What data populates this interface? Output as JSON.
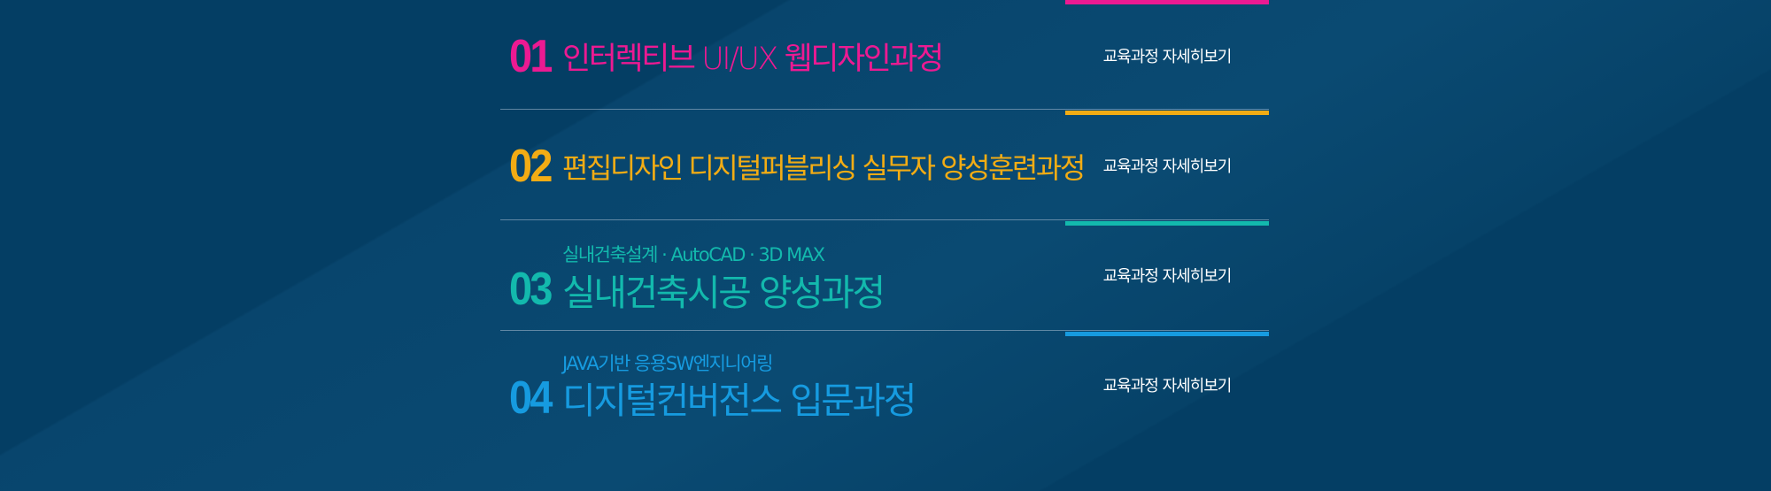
{
  "courses": [
    {
      "number": "01",
      "subtitle": "",
      "title": "인터렉티브 UI/UX 웹디자인과정",
      "detail_label": "교육과정 자세히보기",
      "color": "#ec1a92"
    },
    {
      "number": "02",
      "subtitle": "",
      "title": "편집디자인 디지털퍼블리싱 실무자 양성훈련과정",
      "detail_label": "교육과정 자세히보기",
      "color": "#f2ac14"
    },
    {
      "number": "03",
      "subtitle": "실내건축설계 · AutoCAD ·  3D MAX",
      "title": "실내건축시공 양성과정",
      "detail_label": "교육과정 자세히보기",
      "color": "#13b9ad"
    },
    {
      "number": "04",
      "subtitle": "JAVA기반 응용SW엔지니어링",
      "title": "디지털컨버전스 입문과정",
      "detail_label": "교육과정 자세히보기",
      "color": "#169be0"
    }
  ],
  "colors": {
    "background": "#043e64",
    "divider": "#aabed2",
    "link_text": "#ffffff"
  }
}
